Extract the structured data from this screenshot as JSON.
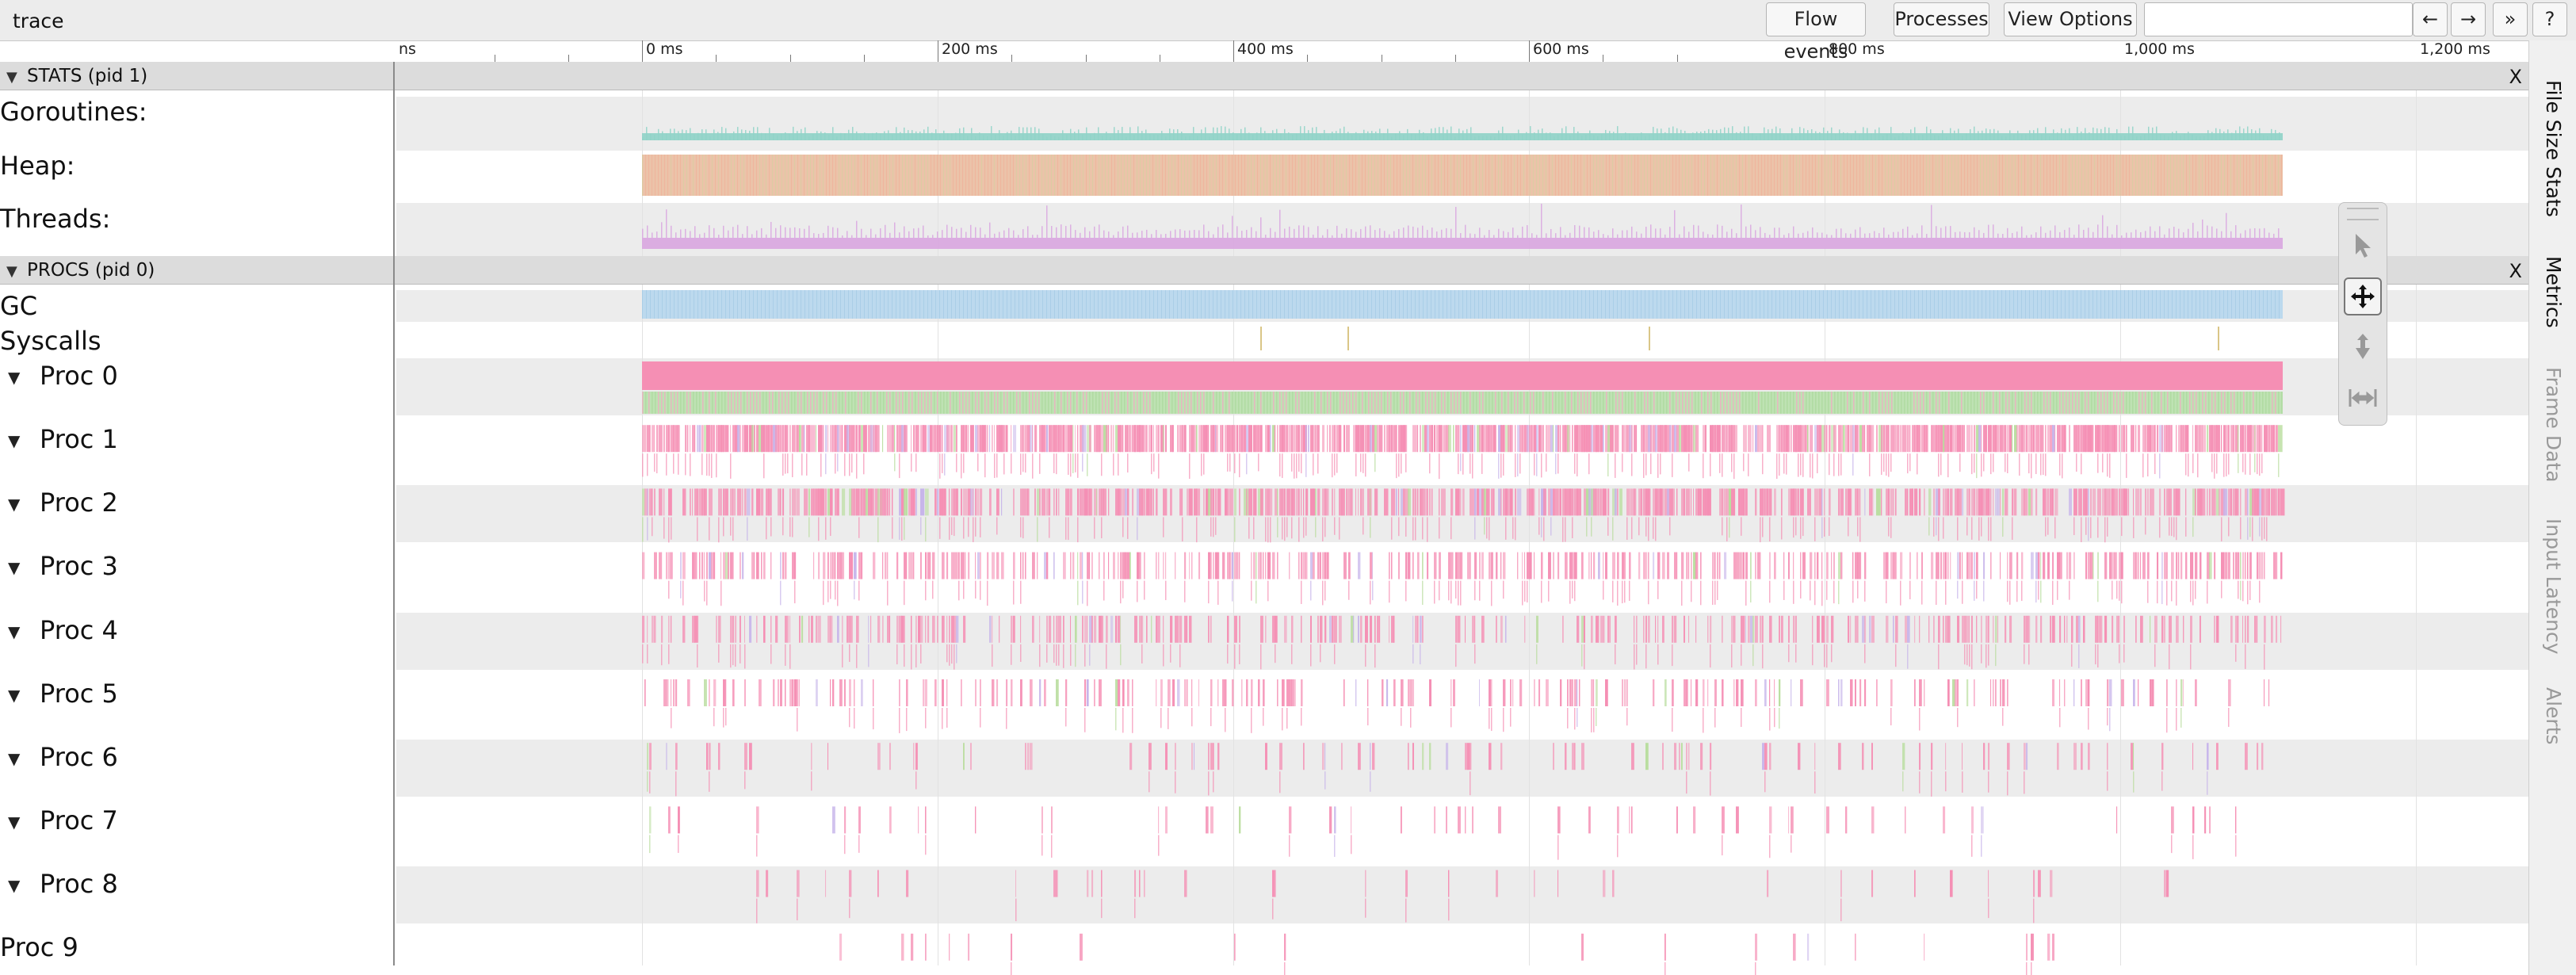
{
  "app": {
    "title": "trace"
  },
  "toolbar": {
    "flow_events": "Flow events",
    "processes": "Processes",
    "view_options": "View Options",
    "search_value": "",
    "prev": "←",
    "next": "→",
    "collapse": "»",
    "help": "?"
  },
  "ruler": {
    "partial_label": "ns",
    "ticks": [
      "0 ms",
      "200 ms",
      "400 ms",
      "600 ms",
      "800 ms",
      "1,000 ms",
      "1,200 ms"
    ]
  },
  "groups": {
    "stats": {
      "label": "STATS (pid 1)",
      "close": "X",
      "tracks": {
        "goroutines": "Goroutines:",
        "heap": "Heap:",
        "threads": "Threads:"
      }
    },
    "procs": {
      "label": "PROCS (pid 0)",
      "close": "X",
      "tracks": {
        "gc": "GC",
        "syscalls": "Syscalls",
        "proc": [
          "Proc 0",
          "Proc 1",
          "Proc 2",
          "Proc 3",
          "Proc 4",
          "Proc 5",
          "Proc 6",
          "Proc 7",
          "Proc 8",
          "Proc 9"
        ]
      }
    }
  },
  "side_tabs": [
    "File Size Stats",
    "Metrics",
    "Frame Data",
    "Input Latency",
    "Alerts"
  ],
  "mouse_modes": [
    "select-icon",
    "pan-icon",
    "zoom-icon",
    "timing-icon"
  ],
  "colors": {
    "goroutines": "#8fd3c8",
    "heap": "#e8b89a",
    "threads": "#d9a6e0",
    "gc": "#bcd9ee",
    "running": "#f58fb4",
    "syscall": "#b9e1ad"
  }
}
